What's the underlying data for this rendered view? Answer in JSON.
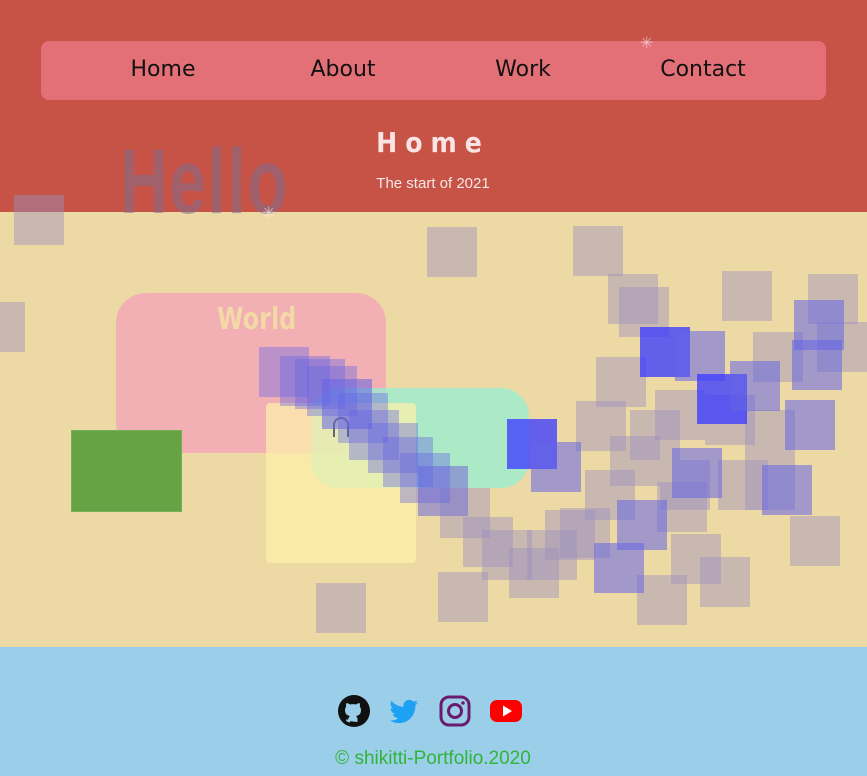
{
  "nav": {
    "items": [
      {
        "label": "Home"
      },
      {
        "label": "About"
      },
      {
        "label": "Work"
      },
      {
        "label": "Contact"
      }
    ]
  },
  "hero": {
    "title": "Home",
    "subtitle": "The start of 2021",
    "hello": "Hello",
    "world": "World"
  },
  "footer": {
    "social": [
      "github-icon",
      "twitter-icon",
      "instagram-icon",
      "youtube-icon"
    ],
    "copyright": "© shikitti-Portfolio.2020"
  },
  "colors": {
    "header_bg": "#c65346",
    "nav_bg": "#e37076",
    "body_bg": "#edd9a4",
    "footer_bg": "#9bcee9",
    "copyright": "#31b539"
  }
}
